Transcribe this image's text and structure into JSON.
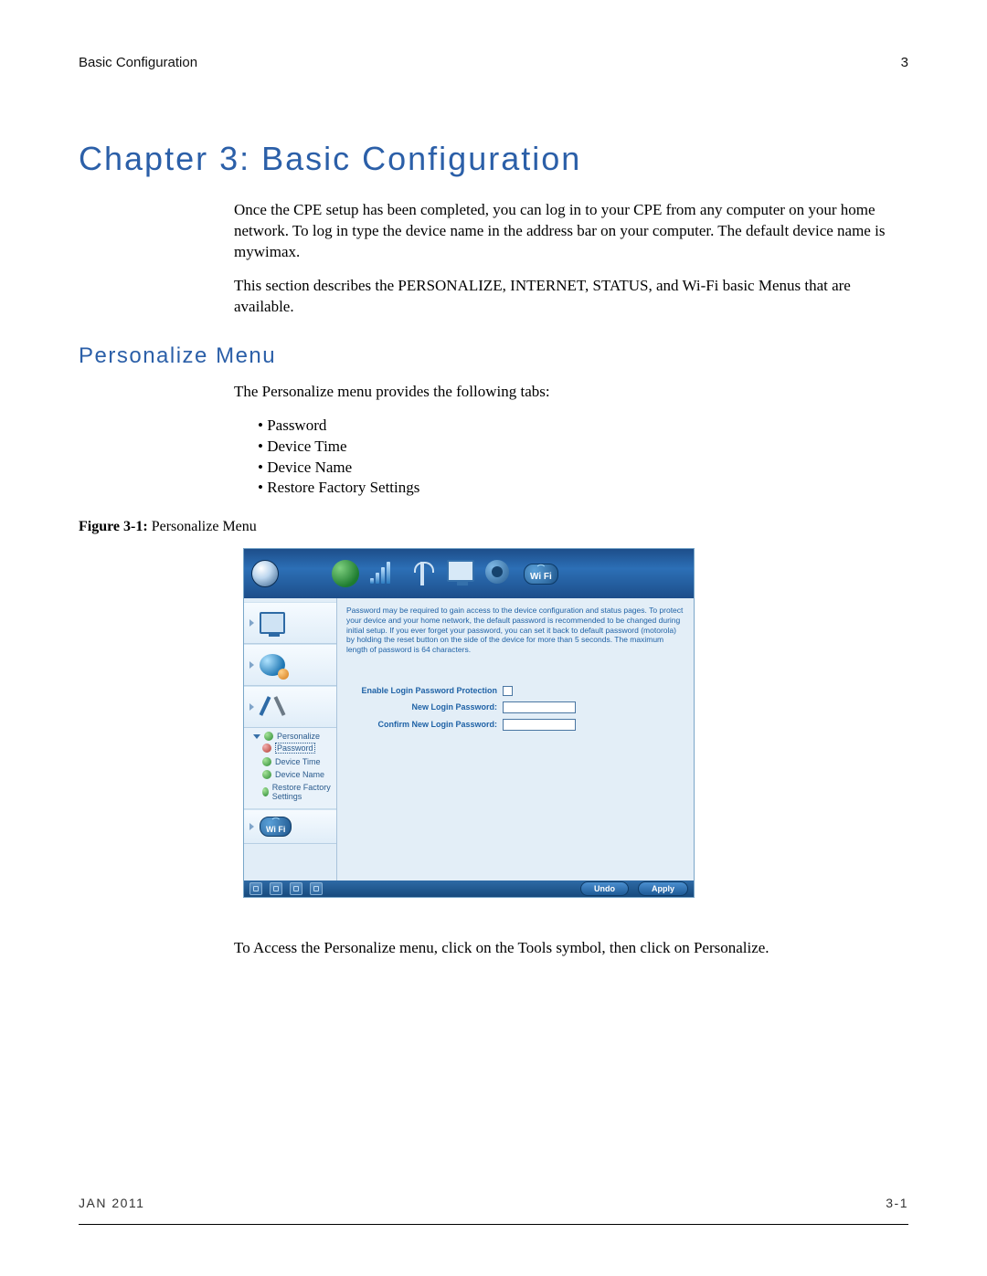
{
  "running_header": {
    "left": "Basic Configuration",
    "right": "3"
  },
  "chapter_title": "Chapter 3: Basic Configuration",
  "intro_p1": "Once the CPE setup has been completed, you can log in to your CPE from any computer on your home network. To log in type the device name in the address bar on your computer. The default device name is mywimax.",
  "intro_p2": "This section describes the PERSONALIZE, INTERNET, STATUS, and Wi-Fi basic Menus that are available.",
  "section_title": "Personalize Menu",
  "tabs_intro": "The Personalize menu provides the following tabs:",
  "tabs": [
    "Password",
    "Device Time",
    "Device Name",
    "Restore Factory Settings"
  ],
  "figure_caption_bold": "Figure 3-1:",
  "figure_caption_rest": " Personalize Menu",
  "after_figure": "To Access the Personalize menu, click on the Tools symbol, then click on Personalize.",
  "footer": {
    "left": "JAN 2011",
    "right": "3-1"
  },
  "ui": {
    "topbar_wifi": "Wi Fi",
    "help_text": "Password may be required to gain access to the device configuration and status pages. To protect your device and your home network, the default password is recommended to be changed during initial setup. If you ever forget your password, you can set it back to default password (motorola) by holding the reset button on the side of the device for more than 5 seconds. The maximum length of password is 64 characters.",
    "form": {
      "enable_label": "Enable Login Password Protection",
      "new_pw_label": "New Login Password:",
      "confirm_pw_label": "Confirm New Login Password:"
    },
    "leftnav": {
      "personalize": "Personalize",
      "items": [
        {
          "label": "Password",
          "selected": true
        },
        {
          "label": "Device Time",
          "selected": false
        },
        {
          "label": "Device Name",
          "selected": false
        },
        {
          "label": "Restore Factory Settings",
          "selected": false
        }
      ],
      "wifi": "Wi Fi"
    },
    "buttons": {
      "undo": "Undo",
      "apply": "Apply"
    }
  }
}
